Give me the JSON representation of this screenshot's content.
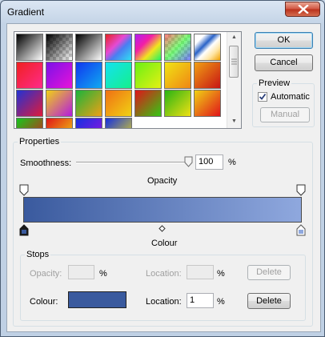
{
  "window": {
    "title": "Gradient"
  },
  "colors": {
    "gradient_start": "#3a5a9e",
    "gradient_end": "#8fa8de",
    "close_button": "#c8412a"
  },
  "presets": [
    {
      "name": "foreground-to-background",
      "css": "linear-gradient(135deg,#000 0%,#fff 100%)"
    },
    {
      "name": "foreground-to-transparent",
      "css": "linear-gradient(135deg,#000 0%,rgba(0,0,0,0) 100%), repeating-conic-gradient(#cfcfcf 0 25%, #ffffff 0 50%) 0 0/8px 8px"
    },
    {
      "name": "black-white",
      "css": "linear-gradient(135deg,#000,#fff)"
    },
    {
      "name": "red-green",
      "css": "linear-gradient(135deg,#e62222,#e54bd4 40%,#4a7df2 60%,#2fe2f2)"
    },
    {
      "name": "violet-orange",
      "css": "linear-gradient(135deg,#b01ef2,#f21ea6 35%,#f2e51e 65%,#1ef266)"
    },
    {
      "name": "transparent-rainbow",
      "css": "linear-gradient(135deg,rgba(255,0,0,0.5),rgba(0,255,0,0.5),rgba(0,0,255,0.5)), repeating-conic-gradient(#d6d6d6 0 25%, #ffffff 0 50%) 0 0/8px 8px"
    },
    {
      "name": "copper",
      "css": "linear-gradient(135deg,#ffffff 20%,#2a63c7 40%,#ffffff 55%,#ffe5a2 75%,#f0a000)"
    },
    {
      "name": "red-pink",
      "css": "linear-gradient(135deg,#f02020,#ff2b8a)"
    },
    {
      "name": "violet-magenta",
      "css": "linear-gradient(135deg,#7a12e8,#e812d9)"
    },
    {
      "name": "blue-cyan",
      "css": "linear-gradient(135deg,#1036f0,#10aaf0)"
    },
    {
      "name": "cyan-green",
      "css": "linear-gradient(135deg,#14e1f0,#14f08c)"
    },
    {
      "name": "green-yellow",
      "css": "linear-gradient(135deg,#6af014,#e4f014)"
    },
    {
      "name": "yellow-orange",
      "css": "linear-gradient(135deg,#f0e414,#f08614)"
    },
    {
      "name": "orange-red",
      "css": "linear-gradient(135deg,#f0a014,#c81414)"
    },
    {
      "name": "blue-red",
      "css": "linear-gradient(135deg,#2232d4,#e01a3a)"
    },
    {
      "name": "yellow-violet",
      "css": "linear-gradient(135deg,#f0d214,#b41ae0)"
    },
    {
      "name": "green-orange",
      "css": "linear-gradient(135deg,#1ab43c,#f0a014)"
    },
    {
      "name": "orange-yellow",
      "css": "linear-gradient(135deg,#f07014,#f0d214)"
    },
    {
      "name": "red-green-2",
      "css": "linear-gradient(135deg,#e0141a,#34c814)"
    },
    {
      "name": "green-yellow-2",
      "css": "linear-gradient(135deg,#28b414,#f0e014)"
    },
    {
      "name": "yellow-red",
      "css": "linear-gradient(135deg,#f0d214,#e0141a)"
    },
    {
      "name": "green-red",
      "css": "linear-gradient(135deg,#14c81e,#e0141a)"
    },
    {
      "name": "red-yellow",
      "css": "linear-gradient(135deg,#e0141a,#f0e014)"
    },
    {
      "name": "blue-violet",
      "css": "linear-gradient(135deg,#1430e0,#a014e0)"
    },
    {
      "name": "blue-yellow",
      "css": "linear-gradient(135deg,#1430e0,#f0e014)"
    }
  ],
  "buttons": {
    "ok": "OK",
    "cancel": "Cancel",
    "manual": "Manual",
    "delete_opacity": "Delete",
    "delete_colour": "Delete"
  },
  "preview": {
    "label": "Preview",
    "automatic": "Automatic",
    "checked": true
  },
  "properties": {
    "label": "Properties",
    "smoothness_label": "Smoothness:",
    "smoothness_value": "100",
    "smoothness_unit": "%",
    "smoothness_level": 1.0,
    "opacity_heading": "Opacity",
    "colour_heading": "Colour"
  },
  "stops": {
    "label": "Stops",
    "opacity_label": "Opacity:",
    "opacity_value": "",
    "opacity_unit": "%",
    "opacity_location_label": "Location:",
    "opacity_location_value": "",
    "opacity_location_unit": "%",
    "colour_label": "Colour:",
    "colour_value": "#3a5a9e",
    "colour_location_label": "Location:",
    "colour_location_value": "1",
    "colour_location_unit": "%"
  }
}
